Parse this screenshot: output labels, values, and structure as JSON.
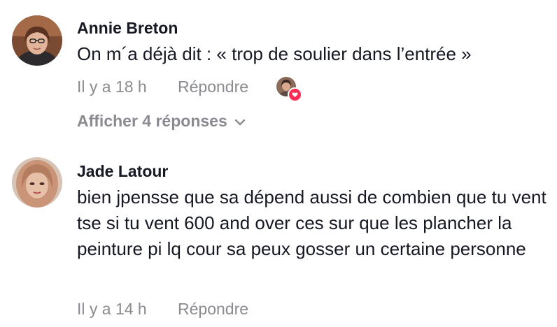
{
  "comments": [
    {
      "author": "Annie Breton",
      "text": "On m´a déjà dit : «  trop de soulier dans l’entrée »",
      "time": "Il y a 18 h",
      "reply_label": "Répondre",
      "show_replies_label": "Afficher 4 réponses"
    },
    {
      "author": "Jade Latour",
      "text": "bien jpensse que sa dépend aussi de combien que tu vent tse si tu vent 600 and over ces sur que les plancher la peinture pi lq cour sa peux gosser un certaine personne",
      "time": "Il y a 14 h",
      "reply_label": "Répondre"
    }
  ],
  "icons": {
    "liked_by_creator": "creator-liked-avatar-icon",
    "heart": "heart-icon",
    "chevron": "chevron-down-icon"
  },
  "colors": {
    "text": "#161823",
    "muted": "#8a8b91",
    "heart": "#fe2c55"
  }
}
